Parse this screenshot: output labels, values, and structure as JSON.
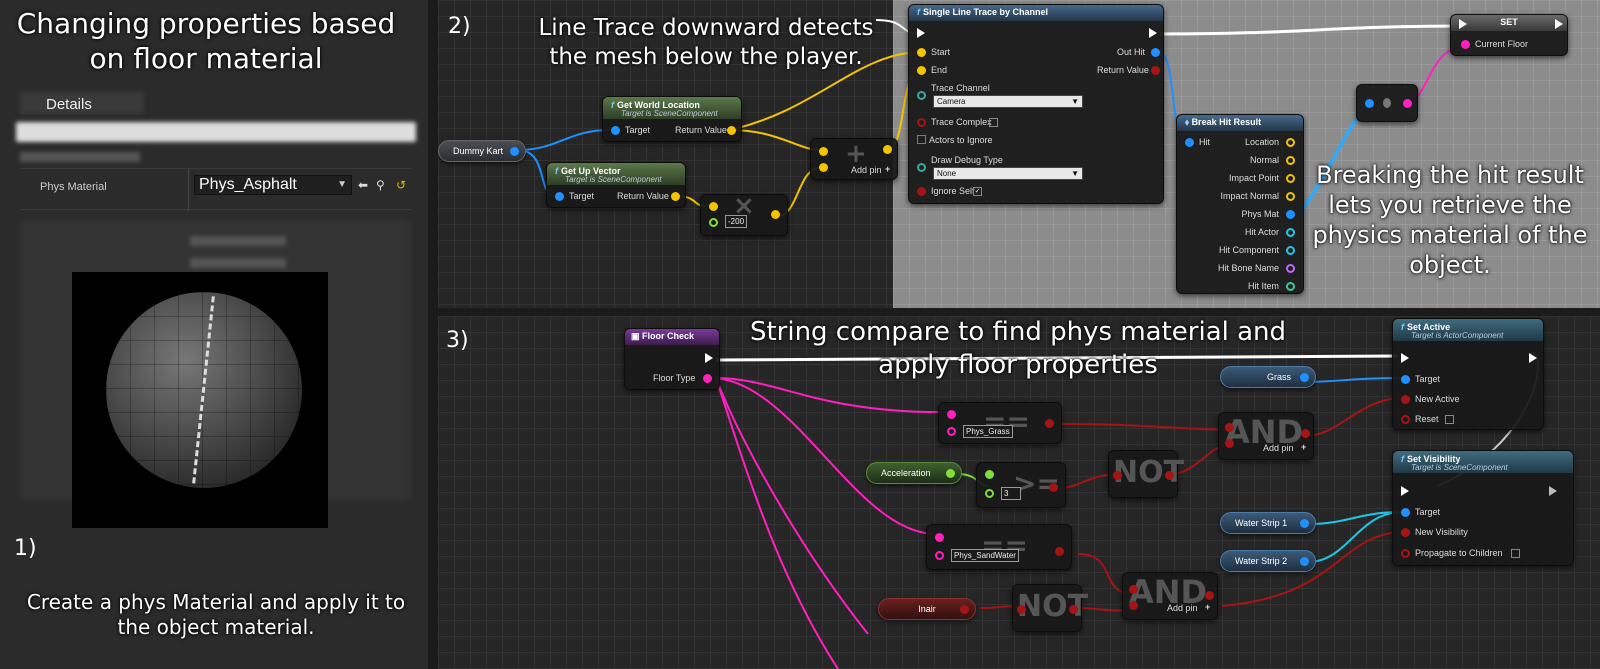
{
  "panel1": {
    "title": "Changing properties based on floor material",
    "details_tab": "Details",
    "property_label": "Phys Material",
    "property_value": "Phys_Asphalt",
    "step_number": "1)",
    "caption": "Create a phys Material and apply it to the object material."
  },
  "panel2": {
    "step_number": "2)",
    "caption_line_trace": "Line Trace downward detects the mesh below the player.",
    "caption_break_hit": "Breaking the hit result lets you retrieve the physics material of the object.",
    "dummy_kart": "Dummy Kart",
    "get_world_location": {
      "title": "Get World Location",
      "subtitle": "Target is SceneComponent",
      "target": "Target",
      "return_value": "Return Value"
    },
    "get_up_vector": {
      "title": "Get Up Vector",
      "subtitle": "Target is SceneComponent",
      "target": "Target",
      "return_value": "Return Value"
    },
    "multiply_value": "-200",
    "add_pin": "Add pin",
    "line_trace": {
      "title": "Single Line Trace by Channel",
      "start": "Start",
      "end": "End",
      "out_hit": "Out Hit",
      "return_value": "Return Value",
      "trace_channel": "Trace Channel",
      "trace_channel_value": "Camera",
      "trace_complex": "Trace Complex",
      "actors_to_ignore": "Actors to Ignore",
      "draw_debug_type": "Draw Debug Type",
      "draw_debug_value": "None",
      "ignore_self": "Ignore Self"
    },
    "break_hit": {
      "title": "Break Hit Result",
      "hit": "Hit",
      "outputs": [
        "Location",
        "Normal",
        "Impact Point",
        "Impact Normal",
        "Phys Mat",
        "Hit Actor",
        "Hit Component",
        "Hit Bone Name",
        "Hit Item"
      ]
    },
    "set_node": {
      "title": "SET",
      "field": "Current Floor"
    }
  },
  "panel3": {
    "step_number": "3)",
    "caption": "String compare to find phys material and apply floor properties",
    "floor_check": {
      "title": "Floor Check",
      "floor_type": "Floor Type"
    },
    "phys_grass": "Phys_Grass",
    "phys_sandwater": "Phys_SandWater",
    "acceleration": "Acceleration",
    "compare_value": "3",
    "inair": "Inair",
    "grass": "Grass",
    "water_strip_1": "Water Strip 1",
    "water_strip_2": "Water Strip 2",
    "op_equal": "==",
    "op_not": "NOT",
    "op_and": "AND",
    "op_gte": ">=",
    "op_multiply": "×",
    "op_add": "+",
    "add_pin": "Add pin",
    "set_active": {
      "title": "Set Active",
      "subtitle": "Target is ActorComponent",
      "target": "Target",
      "new_active": "New Active",
      "reset": "Reset"
    },
    "set_visibility": {
      "title": "Set Visibility",
      "subtitle": "Target is SceneComponent",
      "target": "Target",
      "new_visibility": "New Visibility",
      "propagate": "Propagate to Children"
    }
  },
  "colors": {
    "exec_wire": "#ffffff",
    "object_wire": "#1e90ff",
    "vector_wire": "#f5c400",
    "string_wire": "#ff1fbf",
    "bool_wire": "#a51414"
  }
}
